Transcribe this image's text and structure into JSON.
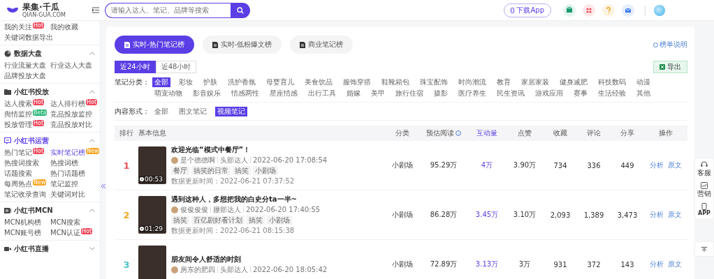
{
  "header": {
    "logo": {
      "name": "果集·千瓜",
      "domain": "QIAN-GUA.COM"
    },
    "search": {
      "placeholder": "请输入达人、笔记、品牌等搜索"
    },
    "download_button": "下载App"
  },
  "sidebar": {
    "top_items": [
      {
        "label": "我的关注",
        "badge": {
          "text": "Hot",
          "color": "#f0465a"
        },
        "selected": false
      },
      {
        "label": "我的收藏",
        "selected": false
      },
      {
        "label": "关键词数据导出",
        "selected": false
      }
    ],
    "sections": [
      {
        "title": "数据大盘",
        "kind": "pie",
        "expanded": true,
        "active": false,
        "items": [
          {
            "label": "行业流量大盘",
            "selected": false
          },
          {
            "label": "行业达人大盘",
            "selected": false
          },
          {
            "label": "品牌投放大盘",
            "selected": false
          }
        ]
      },
      {
        "title": "小红书投放",
        "kind": "folder",
        "expanded": true,
        "active": false,
        "items": [
          {
            "label": "达人搜索",
            "badge": {
              "text": "Hot",
              "color": "#f0465a"
            },
            "selected": false
          },
          {
            "label": "达人排行榜",
            "badge": {
              "text": "Hot",
              "color": "#f0465a"
            },
            "selected": false
          },
          {
            "label": "舆情监控",
            "badge": {
              "text": "Beta",
              "color": "#22b573"
            },
            "selected": false
          },
          {
            "label": "竞品投放监控",
            "selected": false
          },
          {
            "label": "投放管理",
            "badge": {
              "text": "Hot",
              "color": "#f0465a"
            },
            "selected": false
          },
          {
            "label": "竞品投放对比",
            "selected": false
          }
        ]
      },
      {
        "title": "小红书运营",
        "kind": "chat",
        "expanded": true,
        "active": true,
        "items": [
          {
            "label": "热门笔记",
            "badge": {
              "text": "Hot",
              "color": "#f0465a"
            },
            "selected": false
          },
          {
            "label": "实时笔记榜",
            "badge": {
              "text": "New",
              "color": "#f5a623"
            },
            "selected": true
          },
          {
            "label": "热搜词搜索",
            "selected": false
          },
          {
            "label": "热搜词榜",
            "selected": false
          },
          {
            "label": "话题搜索",
            "selected": false
          },
          {
            "label": "热门话题榜",
            "selected": false
          },
          {
            "label": "每周热点",
            "badge": {
              "text": "New",
              "color": "#f5a623"
            },
            "selected": false
          },
          {
            "label": "笔记监控",
            "selected": false
          },
          {
            "label": "笔记收录查询",
            "selected": false
          },
          {
            "label": "关键词对比",
            "selected": false
          }
        ]
      },
      {
        "title": "小红书MCN",
        "kind": "mcn",
        "expanded": true,
        "active": false,
        "items": [
          {
            "label": "MCN机构榜",
            "selected": false
          },
          {
            "label": "MCN搜索",
            "selected": false
          },
          {
            "label": "MCN账号榜",
            "selected": false
          },
          {
            "label": "MCN认证",
            "badge": {
              "text": "Hot",
              "color": "#f0465a"
            },
            "selected": false
          }
        ]
      },
      {
        "title": "小红书直播",
        "kind": "video",
        "expanded": false,
        "active": false
      }
    ]
  },
  "tabs": [
    {
      "label": "实时-热门笔记榜",
      "selected": true
    },
    {
      "label": "实时-低粉爆文榜",
      "selected": false
    },
    {
      "label": "商业笔记榜",
      "selected": false
    }
  ],
  "help_link": "榜单说明",
  "time_ranges": [
    {
      "label": "近24小时",
      "selected": true
    },
    {
      "label": "近48小时",
      "selected": false
    }
  ],
  "export_button": "导出",
  "filters": [
    {
      "label": "笔记分类：",
      "options": [
        {
          "label": "全部",
          "selected": true
        },
        {
          "label": "彩妆",
          "selected": false
        },
        {
          "label": "护肤",
          "selected": false
        },
        {
          "label": "洗护香氛",
          "selected": false
        },
        {
          "label": "母婴育儿",
          "selected": false
        },
        {
          "label": "美食饮品",
          "selected": false
        },
        {
          "label": "服饰穿搭",
          "selected": false
        },
        {
          "label": "鞋靴箱包",
          "selected": false
        },
        {
          "label": "珠宝配饰",
          "selected": false
        },
        {
          "label": "时尚潮流",
          "selected": false
        },
        {
          "label": "教育",
          "selected": false
        },
        {
          "label": "家居家装",
          "selected": false
        },
        {
          "label": "健身减肥",
          "selected": false
        },
        {
          "label": "科技数码",
          "selected": false
        },
        {
          "label": "动漫",
          "selected": false
        },
        {
          "label": "萌宠动物",
          "selected": false
        },
        {
          "label": "影音娱乐",
          "selected": false
        },
        {
          "label": "情感两性",
          "selected": false
        },
        {
          "label": "星座情感",
          "selected": false
        },
        {
          "label": "出行工具",
          "selected": false
        },
        {
          "label": "婚嫁",
          "selected": false
        },
        {
          "label": "美甲",
          "selected": false
        },
        {
          "label": "旅行住宿",
          "selected": false
        },
        {
          "label": "摄影",
          "selected": false
        },
        {
          "label": "医疗养生",
          "selected": false
        },
        {
          "label": "民生资讯",
          "selected": false
        },
        {
          "label": "游戏应用",
          "selected": false
        },
        {
          "label": "赛事",
          "selected": false
        },
        {
          "label": "生活经验",
          "selected": false
        },
        {
          "label": "其他",
          "selected": false
        }
      ]
    },
    {
      "label": "内容形式：",
      "options": [
        {
          "label": "全部",
          "selected": false
        },
        {
          "label": "图文笔记",
          "selected": false
        },
        {
          "label": "视频笔记",
          "selected": true
        }
      ]
    }
  ],
  "table": {
    "columns": [
      {
        "label": "排行",
        "sorted": false
      },
      {
        "label": "基本信息",
        "sorted": false
      },
      {
        "label": "分类",
        "sorted": false
      },
      {
        "label": "预估阅读",
        "sorted": false,
        "info": true
      },
      {
        "label": "互动量",
        "sorted": true
      },
      {
        "label": "点赞",
        "sorted": false
      },
      {
        "label": "收藏",
        "sorted": false
      },
      {
        "label": "评论",
        "sorted": false
      },
      {
        "label": "分享",
        "sorted": false
      },
      {
        "label": "操作",
        "sorted": false
      }
    ],
    "rows": [
      {
        "rank": "1",
        "color": "#e8505b",
        "title": "欢迎光临“模式中餐厅”！",
        "duration": "00:53",
        "author": "是个德德啊",
        "level": "头部达人",
        "time": "2022-06-20 17:08:54",
        "tags": [
          "餐厅",
          "搞笑的日常",
          "搞笑",
          "小剧场"
        ],
        "updated": "数据更新时间：2022-06-21 07:37:52",
        "category": "小剧场",
        "reads": "95.29万",
        "interactions": "4万",
        "likes": "3.90万",
        "favorites": "734",
        "comments": "336",
        "shares": "449",
        "actions": [
          "分析",
          "原文"
        ]
      },
      {
        "rank": "2",
        "color": "#f5a623",
        "title": "遇到这种人，多想把我的白史分ta一半~",
        "duration": "01:29",
        "author": "俊俊俊俊",
        "level": "腰部达人",
        "time": "2022-06-20 17:40:55",
        "tags": [
          "搞笑",
          "百亿剧好看计划",
          "搞笑",
          "小剧场"
        ],
        "updated": "数据更新时间：2022-06-21 08:15:38",
        "category": "小剧场",
        "reads": "86.28万",
        "interactions": "3.45万",
        "likes": "3.10万",
        "favorites": "2,093",
        "comments": "1,389",
        "shares": "3,473",
        "actions": [
          "分析",
          "原文"
        ]
      },
      {
        "rank": "3",
        "color": "#4fc3c7",
        "title": "朋友间令人舒适的时刻",
        "author": "房东的肥四",
        "level": "头部达人",
        "time": "2022-06-20 18:05:42",
        "category": "小剧场",
        "reads": "72.89万",
        "interactions": "3.13万",
        "likes": "3万",
        "favorites": "931",
        "comments": "372",
        "shares": "143",
        "actions": [
          "分析",
          "原文"
        ]
      }
    ]
  },
  "side_panel": [
    {
      "label": "客服",
      "kind": "headset"
    },
    {
      "label": "营销",
      "kind": "chart"
    },
    {
      "label": "APP",
      "kind": "phone"
    }
  ]
}
